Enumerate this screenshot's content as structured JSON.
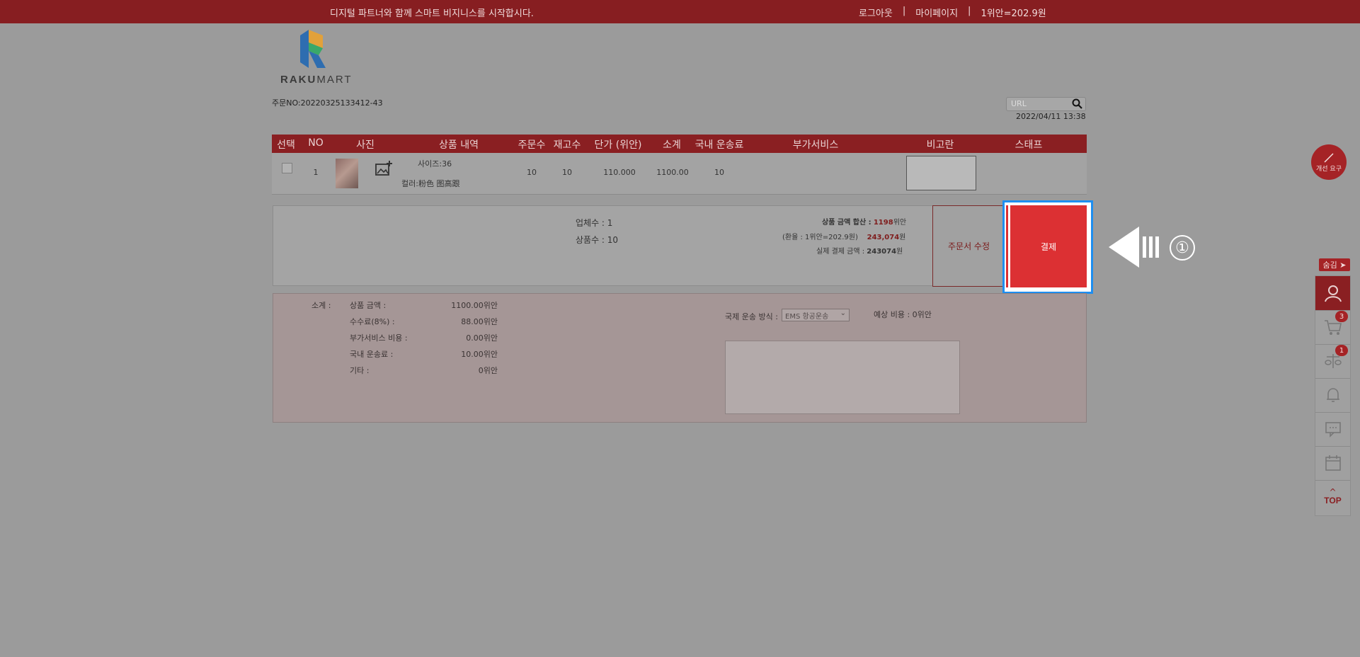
{
  "topbar": {
    "slogan": "디지털 파트너와 함께 스마트 비지니스를 시작합시다.",
    "logout": "로그아웃",
    "sep": "|",
    "mypage": "마이페이지",
    "sep2": "|",
    "rate": "1위안=202.9원"
  },
  "logo": {
    "brand_a": "RAKU",
    "brand_b": "MART"
  },
  "order": {
    "label": "주문NO:20220325133412-43",
    "datetime": "2022/04/11 13:38"
  },
  "search": {
    "placeholder": "URL"
  },
  "table": {
    "headers": [
      "선택",
      "NO",
      "사진",
      "상품 내역",
      "주문수",
      "재고수",
      "단가 (위안)",
      "소계",
      "국내 운송료",
      "부가서비스",
      "비고란",
      "스태프"
    ],
    "row": {
      "no": "1",
      "size": "사이즈:36",
      "color": "컬러:粉色 图高跟",
      "order_qty": "10",
      "stock_qty": "10",
      "unit_price": "110.000",
      "subtotal": "1100.00",
      "domestic_shipping": "10"
    }
  },
  "summary": {
    "vendors": "업체수 : 1",
    "items": "상품수 : 10",
    "total_label": "상품 금액 합산 :",
    "total_value": "1198",
    "total_unit": "위안",
    "rate_label": "(환율 : 1위안=202.9원)",
    "rate_value": "243,074",
    "rate_unit": "원",
    "actual_label": "실제 결제 금액 :",
    "actual_value": "243074",
    "actual_unit": "원"
  },
  "buttons": {
    "edit": "주문서 수정",
    "pay": "결제"
  },
  "annotation": {
    "step": "①"
  },
  "detail": {
    "subtotal_label": "소계 :",
    "rows": [
      {
        "label": "상품 금액 :",
        "value": "1100.00위안"
      },
      {
        "label": "수수료(8%) :",
        "value": "88.00위안"
      },
      {
        "label": "부가서비스 비용 :",
        "value": "0.00위안"
      },
      {
        "label": "국내 운송료 :",
        "value": "10.00위안"
      },
      {
        "label": "기타 :",
        "value": "0위안"
      }
    ],
    "intl_shipping_label": "국제 운송 방식 :",
    "intl_shipping_value": "EMS 항공운송",
    "estimate": "예상 비용 : 0위안"
  },
  "sidebar": {
    "feedback": "개선 요구",
    "hide": "숨김",
    "cart_count": "3",
    "wish_count": "1",
    "top": "TOP"
  }
}
